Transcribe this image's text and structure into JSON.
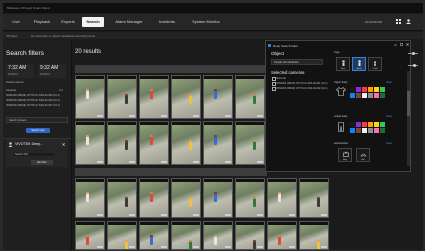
{
  "titlebar": {
    "text": "Milestone XProtect Smart Client"
  },
  "nav": {
    "tabs": [
      {
        "label": "Live",
        "active": false
      },
      {
        "label": "Playback",
        "active": false
      },
      {
        "label": "Exports",
        "active": false
      },
      {
        "label": "Search",
        "active": true
      },
      {
        "label": "Alarm Manager",
        "active": false
      },
      {
        "label": "Incidents",
        "active": false
      },
      {
        "label": "System Monitor",
        "active": false
      }
    ],
    "clock": "10:23:50 AM"
  },
  "infobar": {
    "app": "XProtect",
    "message": "No data files or object metadata recording found"
  },
  "left": {
    "title": "Search filters",
    "start_time": "7:32 AM",
    "start_date": "10/13/21",
    "end_time": "9:32 AM",
    "end_date": "10/13/21",
    "time_label": "Custom interval",
    "camera_label": "Cameras",
    "edit_link": "Edit",
    "cameras": [
      "VDS1000 (08016) VOTH-UC-SSS-00-005 (10.1)",
      "VDS1000 (08016) VOTH-UC-SSS-00-006 (10.1)",
      "VDS1000 (08016) VOTH-UC-SSS-00-007 (10.1)"
    ],
    "select_label": "Search subsets",
    "search_button": "Search now",
    "card": {
      "title": "VIVOTEK Deep...",
      "input": "Search filter",
      "button": "Edit filter"
    }
  },
  "results": {
    "title": "20 results"
  },
  "dialog": {
    "title": "Deep Search Filter",
    "object_heading": "Object",
    "object_value": "People with attributes",
    "selected_cameras_heading": "Selected cameras",
    "select_all": "Select all",
    "cameras": [
      "VDS1000 (08016) VOTH-UC-SSS-00-001 (10.1)",
      "VDS1000 (08016) VOTH-UC-SSS-00-002 (10.1)"
    ],
    "type_label": "Type",
    "type_options": [
      "Any",
      "Adult",
      "Child"
    ],
    "upper_label": "Upper body",
    "lower_label": "Lower body",
    "accessories_label": "Accessories",
    "accessory_options": [
      "Bag",
      "Hat"
    ],
    "clear_label": "Clear",
    "colors": [
      "#1a1a1a",
      "#8a2be2",
      "#ff3b30",
      "#ff9f0a",
      "#ffd60a",
      "#34c759",
      "#0a84ff",
      "#7a4a2a",
      "#f2f2f2",
      "#8e8e93",
      "#ff6fb0",
      "#1f6b3a"
    ]
  },
  "icons": [
    "grid-view-icon",
    "user-icon",
    "clock-icon",
    "camera-icon",
    "shirt-icon",
    "pants-icon",
    "bag-icon",
    "hat-icon",
    "close-icon"
  ]
}
